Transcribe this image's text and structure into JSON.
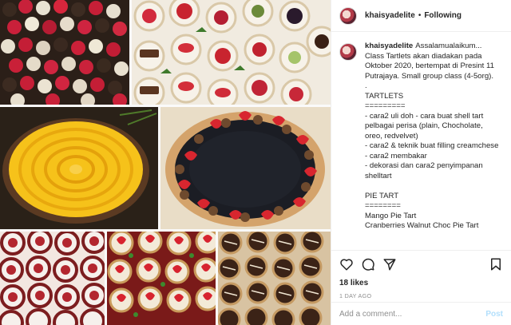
{
  "post": {
    "username": "khaisyadelite",
    "following_label": "Following",
    "separator": "•"
  },
  "caption": {
    "username": "khaisyadelite",
    "lines": [
      "Assalamualaikum... Class Tartlets akan diadakan pada Oktober 2020, bertempat di Presint 11 Putrajaya. Small group class (4-5org).",
      ".",
      "TARTLETS",
      "=========",
      "- cara2 uli doh - cara buat shell tart pelbagai perisa (plain, Chocholate, oreo, redvelvet)",
      "- cara2 & teknik buat filling creamchese",
      "- cara2 membakar",
      "- dekorasi dan cara2 penyimpanan shelltart",
      "",
      "PIE TART",
      "========",
      "Mango Pie Tart",
      "Cranberries Walnut Choc Pie Tart"
    ]
  },
  "engagement": {
    "likes": "18 likes",
    "time_ago": "1 DAY AGO"
  },
  "icons": {
    "like": "heart-icon",
    "comment": "comment-icon",
    "share": "share-icon",
    "save": "bookmark-icon"
  },
  "comment_box": {
    "placeholder": "Add a comment...",
    "post_label": "Post"
  },
  "colors": {
    "accent_disabled": "#b2dffc",
    "muted": "#8e8e8e",
    "text": "#262626",
    "border": "#efefef"
  }
}
